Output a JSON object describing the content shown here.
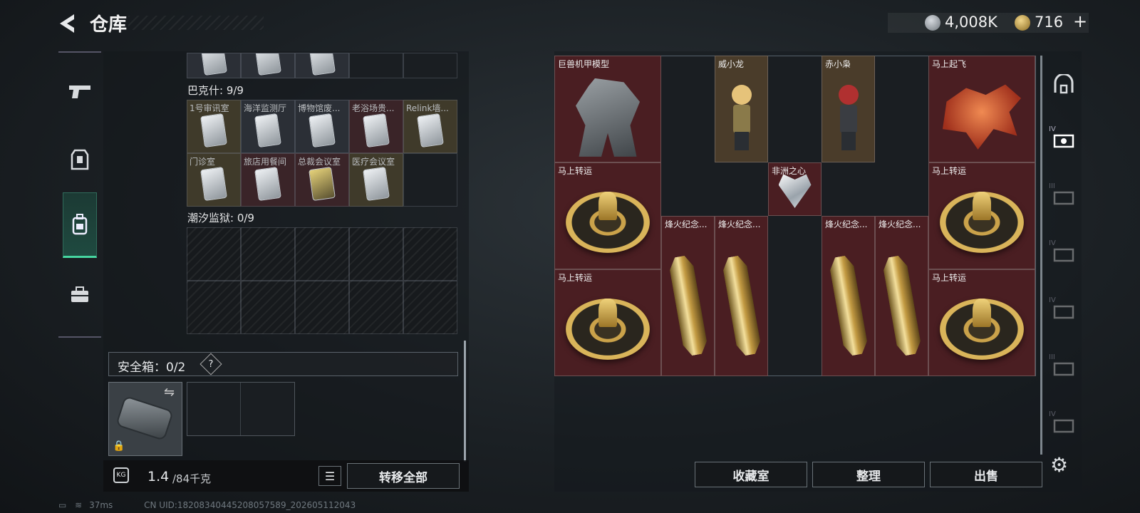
{
  "header": {
    "title": "仓库",
    "cash_amount": "4,008K",
    "gold_amount": "716",
    "add_label": "+"
  },
  "left_nav": {
    "items": [
      {
        "icon": "pistol-icon"
      },
      {
        "icon": "armor-icon"
      },
      {
        "icon": "backpack-icon",
        "active": true
      },
      {
        "icon": "briefcase-icon"
      }
    ]
  },
  "collections": [
    {
      "label": "巴克什: 9/9",
      "cards": [
        "1号审讯室",
        "海洋监测厅",
        "博物馆废...",
        "老浴场贵...",
        "Relink墙...",
        "门诊室",
        "旅店用餐间",
        "总裁会议室",
        "医疗会议室"
      ]
    },
    {
      "label": "潮汐监狱: 0/9",
      "cards": []
    }
  ],
  "safebox": {
    "label": "安全箱：0/2",
    "help": "?",
    "swap_glyph": "⇋",
    "lock_glyph": "🔒"
  },
  "weight": {
    "icon_text": "KG",
    "current": "1.4",
    "max": "/84千克"
  },
  "actions": {
    "transfer_all": "转移全部",
    "list_glyph": "☰",
    "collection_room": "收藏室",
    "sort": "整理",
    "sell": "出售"
  },
  "vault_items": [
    {
      "name": "巨兽机甲模型",
      "kind": "mech",
      "tone": "red"
    },
    {
      "name": "威小龙",
      "kind": "figure-a",
      "tone": "tan"
    },
    {
      "name": "赤小枭",
      "kind": "figure-b",
      "tone": "tan"
    },
    {
      "name": "马上起飞",
      "kind": "horse",
      "tone": "red"
    },
    {
      "name": "马上转运",
      "kind": "wheel",
      "tone": "red"
    },
    {
      "name": "非洲之心",
      "kind": "heart",
      "tone": "red"
    },
    {
      "name": "马上转运",
      "kind": "wheel",
      "tone": "red"
    },
    {
      "name": "烽火纪念...",
      "kind": "pillar",
      "tone": "red"
    },
    {
      "name": "烽火纪念...",
      "kind": "pillar",
      "tone": "red"
    },
    {
      "name": "烽火纪念...",
      "kind": "pillar",
      "tone": "red"
    },
    {
      "name": "烽火纪念...",
      "kind": "pillar",
      "tone": "red"
    },
    {
      "name": "马上转运",
      "kind": "wheel",
      "tone": "red"
    },
    {
      "name": "马上转运",
      "kind": "wheel",
      "tone": "red"
    }
  ],
  "side_tabs": [
    {
      "icon": "vault-arch-icon",
      "tier": ""
    },
    {
      "icon": "storage-iv-icon",
      "tier": "IV"
    },
    {
      "icon": "storage-iii-icon",
      "tier": "III"
    },
    {
      "icon": "storage-iv-b-icon",
      "tier": "IV"
    },
    {
      "icon": "storage-iv-c-icon",
      "tier": "IV"
    },
    {
      "icon": "storage-iii-b-icon",
      "tier": "III"
    },
    {
      "icon": "storage-iv-d-icon",
      "tier": "IV"
    }
  ],
  "status": {
    "ping": "37ms",
    "uid": "CN UID:18208340445208057589_202605112043"
  },
  "colors": {
    "accent_green": "#46d6a0",
    "item_red": "#4a1e22",
    "item_tan": "#4a3c2a"
  }
}
